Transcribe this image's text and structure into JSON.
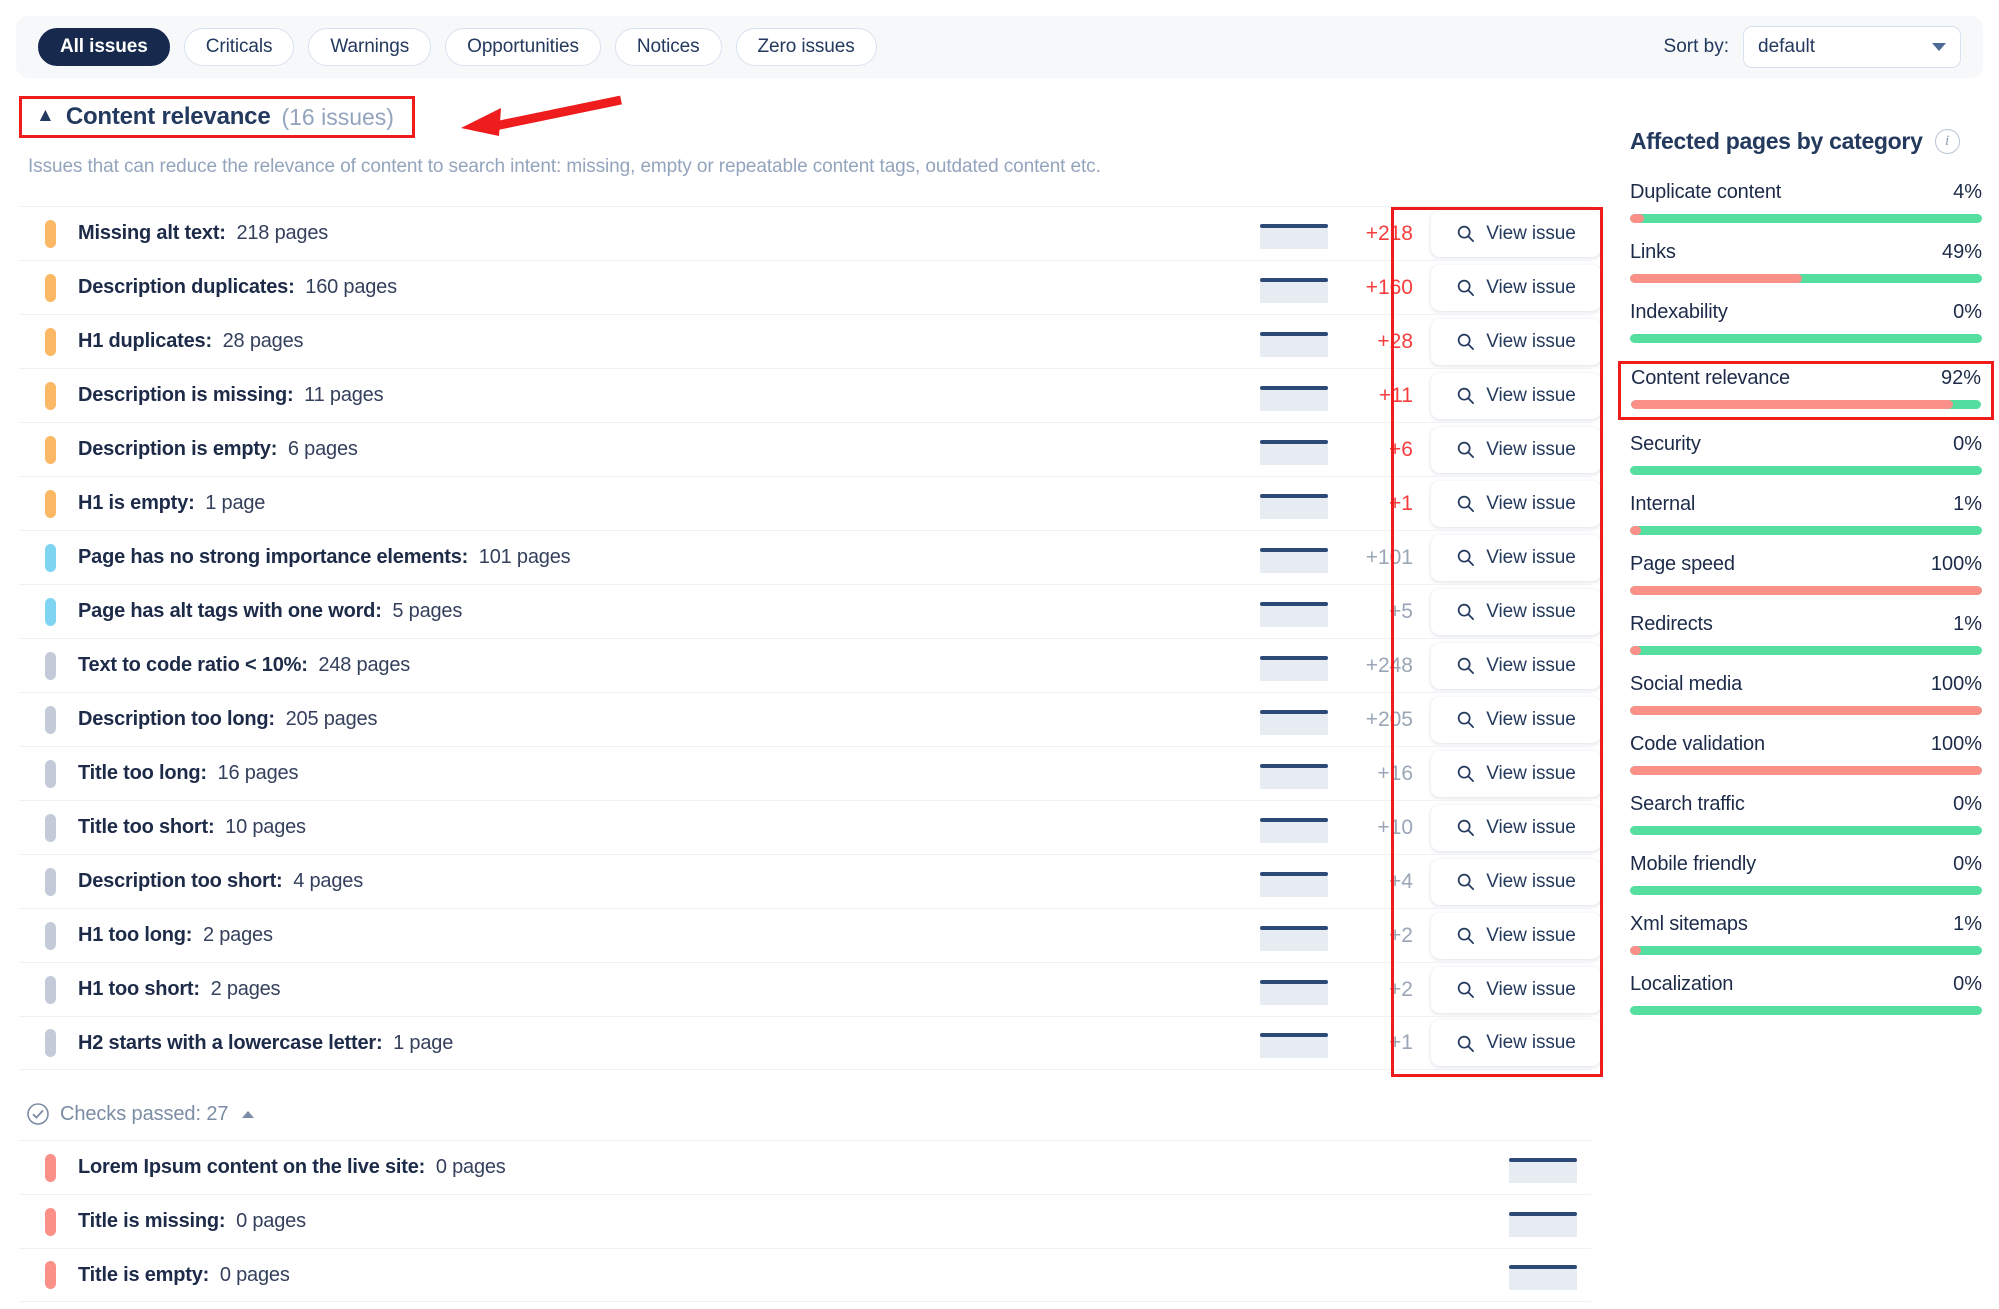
{
  "toolbar": {
    "tabs": [
      {
        "label": "All issues",
        "active": true
      },
      {
        "label": "Criticals",
        "active": false
      },
      {
        "label": "Warnings",
        "active": false
      },
      {
        "label": "Opportunities",
        "active": false
      },
      {
        "label": "Notices",
        "active": false
      },
      {
        "label": "Zero issues",
        "active": false
      }
    ],
    "sort_label": "Sort by:",
    "sort_value": "default"
  },
  "section": {
    "title": "Content relevance",
    "count": "(16 issues)",
    "chevron": "chevron-up",
    "description": "Issues that can reduce the relevance of content to search intent: missing, empty or repeatable content tags, outdated content etc."
  },
  "view_issue_label": "View issue",
  "issues": [
    {
      "name": "Missing alt text:",
      "pages": "218 pages",
      "severity": "warning",
      "delta": "+218",
      "delta_dir": "up"
    },
    {
      "name": "Description duplicates:",
      "pages": "160 pages",
      "severity": "warning",
      "delta": "+160",
      "delta_dir": "up"
    },
    {
      "name": "H1 duplicates:",
      "pages": "28 pages",
      "severity": "warning",
      "delta": "+28",
      "delta_dir": "up"
    },
    {
      "name": "Description is missing:",
      "pages": "11 pages",
      "severity": "warning",
      "delta": "+11",
      "delta_dir": "up"
    },
    {
      "name": "Description is empty:",
      "pages": "6 pages",
      "severity": "warning",
      "delta": "+6",
      "delta_dir": "up"
    },
    {
      "name": "H1 is empty:",
      "pages": "1 page",
      "severity": "warning",
      "delta": "+1",
      "delta_dir": "up"
    },
    {
      "name": "Page has no strong importance elements:",
      "pages": "101 pages",
      "severity": "opportunity",
      "delta": "+101",
      "delta_dir": "flat"
    },
    {
      "name": "Page has alt tags with one word:",
      "pages": "5 pages",
      "severity": "opportunity",
      "delta": "+5",
      "delta_dir": "flat"
    },
    {
      "name": "Text to code ratio < 10%:",
      "pages": "248 pages",
      "severity": "notice",
      "delta": "+248",
      "delta_dir": "flat"
    },
    {
      "name": "Description too long:",
      "pages": "205 pages",
      "severity": "notice",
      "delta": "+205",
      "delta_dir": "flat"
    },
    {
      "name": "Title too long:",
      "pages": "16 pages",
      "severity": "notice",
      "delta": "+16",
      "delta_dir": "flat"
    },
    {
      "name": "Title too short:",
      "pages": "10 pages",
      "severity": "notice",
      "delta": "+10",
      "delta_dir": "flat"
    },
    {
      "name": "Description too short:",
      "pages": "4 pages",
      "severity": "notice",
      "delta": "+4",
      "delta_dir": "flat"
    },
    {
      "name": "H1 too long:",
      "pages": "2 pages",
      "severity": "notice",
      "delta": "+2",
      "delta_dir": "flat"
    },
    {
      "name": "H1 too short:",
      "pages": "2 pages",
      "severity": "notice",
      "delta": "+2",
      "delta_dir": "flat"
    },
    {
      "name": "H2 starts with a lowercase letter:",
      "pages": "1 page",
      "severity": "notice",
      "delta": "+1",
      "delta_dir": "flat"
    }
  ],
  "checks_passed": {
    "label": "Checks passed: 27",
    "items": [
      {
        "name": "Lorem Ipsum content on the live site:",
        "pages": "0 pages",
        "severity": "critical"
      },
      {
        "name": "Title is missing:",
        "pages": "0 pages",
        "severity": "critical"
      },
      {
        "name": "Title is empty:",
        "pages": "0 pages",
        "severity": "critical"
      }
    ]
  },
  "sidebar": {
    "title": "Affected pages by category",
    "categories": [
      {
        "name": "Duplicate content",
        "pct": "4%",
        "value": 4,
        "highlight": false
      },
      {
        "name": "Links",
        "pct": "49%",
        "value": 49,
        "highlight": false
      },
      {
        "name": "Indexability",
        "pct": "0%",
        "value": 0,
        "highlight": false
      },
      {
        "name": "Content relevance",
        "pct": "92%",
        "value": 92,
        "highlight": true
      },
      {
        "name": "Security",
        "pct": "0%",
        "value": 0,
        "highlight": false
      },
      {
        "name": "Internal",
        "pct": "1%",
        "value": 1,
        "highlight": false
      },
      {
        "name": "Page speed",
        "pct": "100%",
        "value": 100,
        "highlight": false
      },
      {
        "name": "Redirects",
        "pct": "1%",
        "value": 1,
        "highlight": false
      },
      {
        "name": "Social media",
        "pct": "100%",
        "value": 100,
        "highlight": false
      },
      {
        "name": "Code validation",
        "pct": "100%",
        "value": 100,
        "highlight": false
      },
      {
        "name": "Search traffic",
        "pct": "0%",
        "value": 0,
        "highlight": false
      },
      {
        "name": "Mobile friendly",
        "pct": "0%",
        "value": 0,
        "highlight": false
      },
      {
        "name": "Xml sitemaps",
        "pct": "1%",
        "value": 1,
        "highlight": false
      },
      {
        "name": "Localization",
        "pct": "0%",
        "value": 0,
        "highlight": false
      }
    ]
  },
  "colors": {
    "accent_navy": "#17294d",
    "warning": "#fbb865",
    "opportunity": "#7fd4f2",
    "notice": "#c3cbd8",
    "critical": "#fb9089",
    "delta_up": "#f63d3d",
    "bar_affected": "#fb9089",
    "bar_ok": "#54dea0",
    "annotation": "#ee1c1c"
  }
}
